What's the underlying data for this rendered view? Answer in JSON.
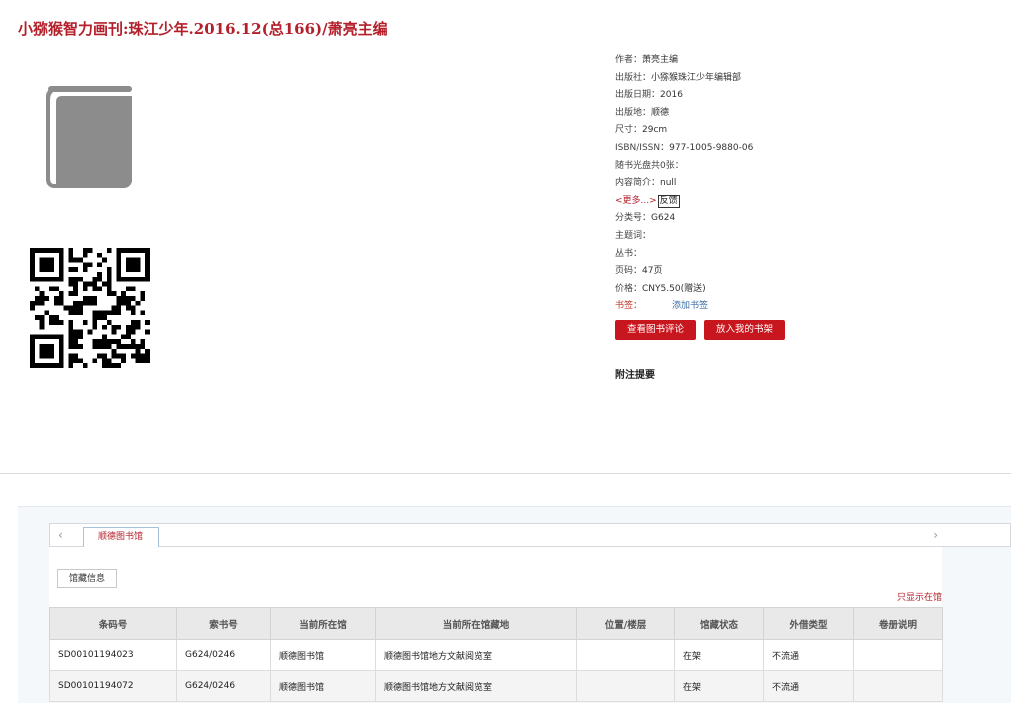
{
  "title": "小猕猴智力画刊:珠江少年.2016.12(总166)/萧亮主编",
  "cover": {
    "icon": "book-icon"
  },
  "qr": {
    "icon": "qr-code"
  },
  "meta": {
    "author": {
      "label": "作者：",
      "value": "萧亮主编"
    },
    "publisher": {
      "label": "出版社：",
      "value": "小猕猴珠江少年编辑部"
    },
    "pub_date": {
      "label": "出版日期：",
      "value": "2016"
    },
    "pub_place": {
      "label": "出版地：",
      "value": "顺德"
    },
    "size": {
      "label": "尺寸：",
      "value": "29cm"
    },
    "isbn": {
      "label": "ISBN/ISSN：",
      "value": "977-1005-9880-06"
    },
    "cd": {
      "label": "随书光盘共0张：",
      "value": ""
    },
    "summary": {
      "label": "内容简介：",
      "value": "null"
    },
    "more": "<更多...>",
    "feedback": "反馈",
    "classno": {
      "label": "分类号：",
      "value": "G624"
    },
    "subject": {
      "label": "主题词：",
      "value": ""
    },
    "series": {
      "label": "丛书：",
      "value": ""
    },
    "pages": {
      "label": "页码：",
      "value": "47页"
    },
    "price": {
      "label": "价格：",
      "value": "CNY5.50(赠送)"
    },
    "bookmark": {
      "label": "书签：",
      "link": "添加书签"
    }
  },
  "buttons": {
    "review": "查看图书评论",
    "shelf": "放入我的书架"
  },
  "appendix_title": "附注提要",
  "library_tab": "顺德图书馆",
  "holdings_tab": "馆藏信息",
  "only_show": "只显示在馆",
  "table": {
    "headers": [
      "条码号",
      "索书号",
      "当前所在馆",
      "当前所在馆藏地",
      "位置/楼层",
      "馆藏状态",
      "外借类型",
      "卷册说明"
    ],
    "rows": [
      [
        "SD00101194023",
        "G624/0246",
        "顺德图书馆",
        "顺德图书馆地方文献阅览室",
        "",
        "在架",
        "不流通",
        ""
      ],
      [
        "SD00101194072",
        "G624/0246",
        "顺德图书馆",
        "顺德图书馆地方文献阅览室",
        "",
        "在架",
        "不流通",
        ""
      ]
    ]
  }
}
